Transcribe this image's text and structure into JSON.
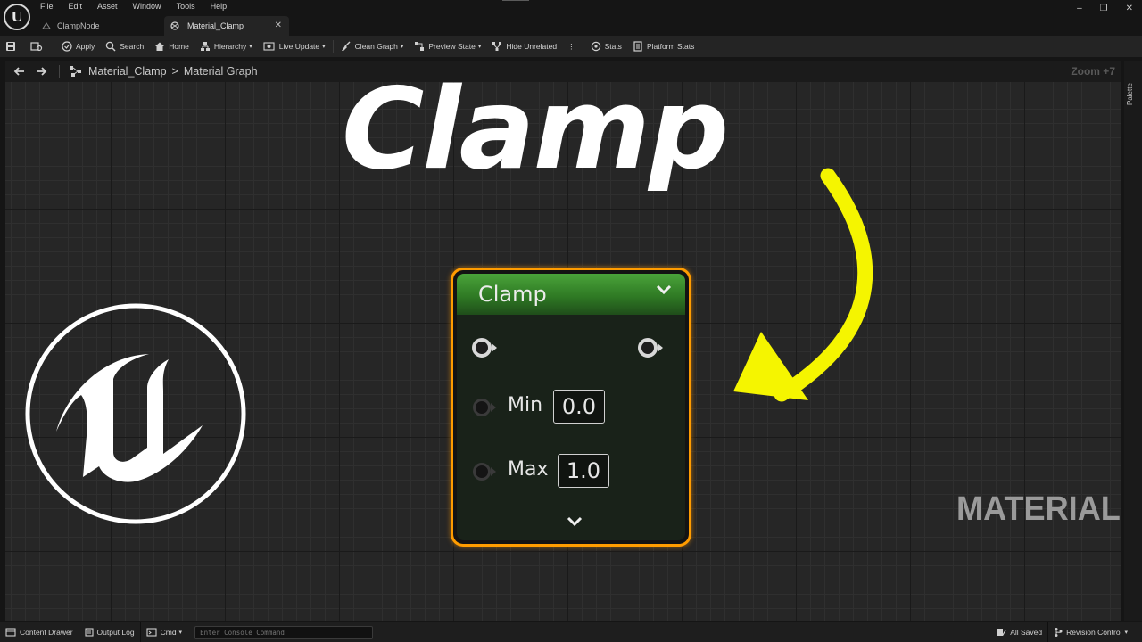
{
  "menu": {
    "items": [
      "File",
      "Edit",
      "Asset",
      "Window",
      "Tools",
      "Help"
    ]
  },
  "tabs": [
    {
      "label": "ClampNode"
    },
    {
      "label": "Material_Clamp"
    }
  ],
  "toolbar": {
    "apply": "Apply",
    "search": "Search",
    "home": "Home",
    "hierarchy": "Hierarchy",
    "live_update": "Live Update",
    "clean_graph": "Clean Graph",
    "preview_state": "Preview State",
    "hide_unrelated": "Hide Unrelated",
    "stats": "Stats",
    "platform_stats": "Platform Stats"
  },
  "breadcrumb": {
    "asset": "Material_Clamp",
    "graph": "Material Graph",
    "zoom": "Zoom +7"
  },
  "palette_label": "Palette",
  "overlay": {
    "title": "Clamp",
    "watermark": "MATERIAL",
    "arrow_color": "#f5f500"
  },
  "node": {
    "title": "Clamp",
    "header_color": "#3d8f2e",
    "border_color": "#ff9c00",
    "min_label": "Min",
    "min_value": "0.0",
    "max_label": "Max",
    "max_value": "1.0"
  },
  "statusbar": {
    "content_drawer": "Content Drawer",
    "output_log": "Output Log",
    "cmd": "Cmd",
    "console_placeholder": "Enter Console Command",
    "all_saved": "All Saved",
    "revision_control": "Revision Control"
  }
}
